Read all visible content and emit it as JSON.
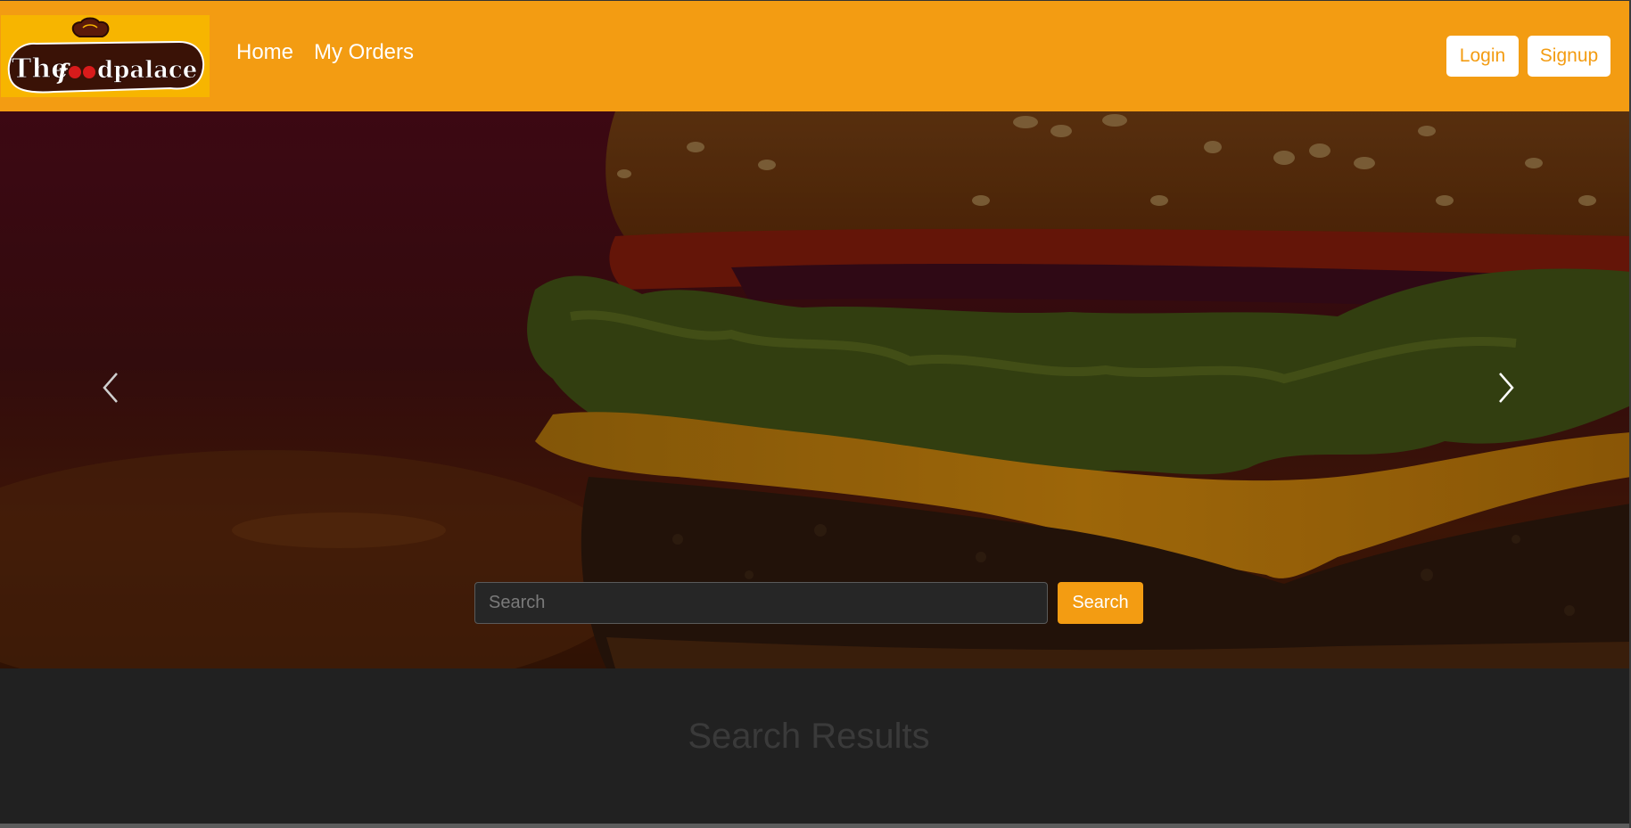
{
  "brand": {
    "logo_text": "Thefoodpalace",
    "logo_bg": "#f7b500"
  },
  "navbar": {
    "background": "#f39c12",
    "links": [
      {
        "label": "Home"
      },
      {
        "label": "My Orders"
      }
    ],
    "login_label": "Login",
    "signup_label": "Signup"
  },
  "hero": {
    "carousel_prev_icon": "chevron-left-icon",
    "carousel_next_icon": "chevron-right-icon",
    "search_placeholder": "Search",
    "search_value": "",
    "search_button_label": "Search"
  },
  "results": {
    "title": "Search Results"
  },
  "colors": {
    "accent": "#f39c12",
    "page_bg": "#212121",
    "button_text": "#ffffff"
  }
}
